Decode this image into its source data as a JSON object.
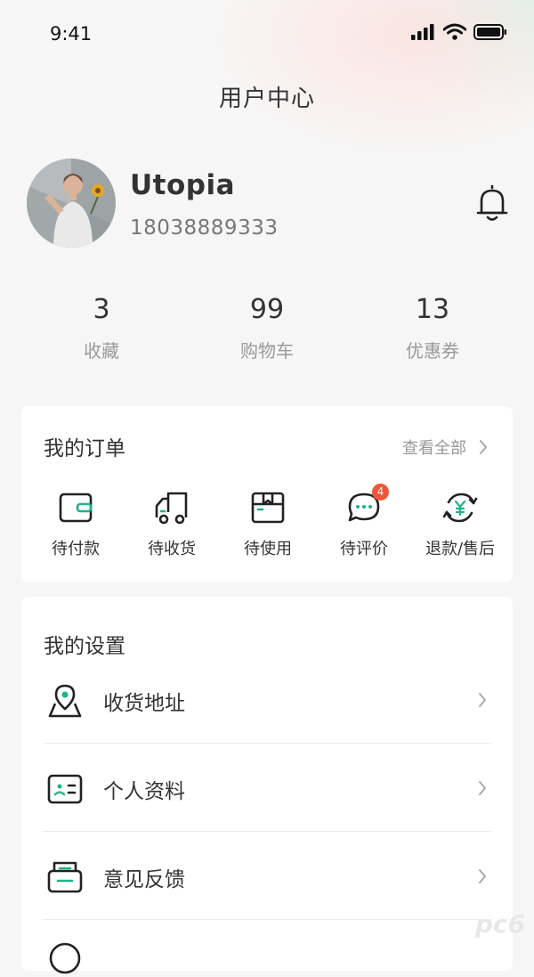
{
  "status_bar": {
    "time": "9:41"
  },
  "header": {
    "title": "用户中心"
  },
  "profile": {
    "username": "Utopia",
    "phone": "18038889333"
  },
  "stats": [
    {
      "value": "3",
      "label": "收藏"
    },
    {
      "value": "99",
      "label": "购物车"
    },
    {
      "value": "13",
      "label": "优惠券"
    }
  ],
  "orders": {
    "title": "我的订单",
    "view_all": "查看全部",
    "items": [
      {
        "label": "待付款",
        "icon": "wallet-icon"
      },
      {
        "label": "待收货",
        "icon": "truck-icon"
      },
      {
        "label": "待使用",
        "icon": "box-icon"
      },
      {
        "label": "待评价",
        "icon": "comment-icon",
        "badge": "4"
      },
      {
        "label": "退款/售后",
        "icon": "refund-icon"
      }
    ]
  },
  "settings": {
    "title": "我的设置",
    "items": [
      {
        "label": "收货地址",
        "icon": "map-pin-icon"
      },
      {
        "label": "个人资料",
        "icon": "id-card-icon"
      },
      {
        "label": "意见反馈",
        "icon": "feedback-icon"
      }
    ]
  },
  "colors": {
    "accent": "#1fb48a",
    "badge": "#f2553b",
    "text": "#333333",
    "muted": "#999999"
  }
}
